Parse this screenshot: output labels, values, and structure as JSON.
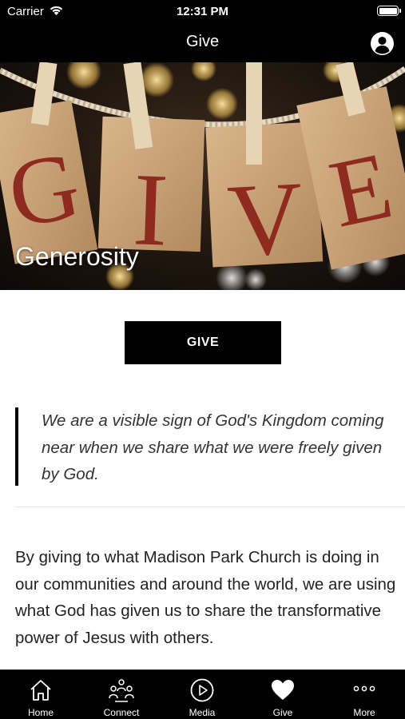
{
  "status_bar": {
    "carrier": "Carrier",
    "time": "12:31 PM"
  },
  "nav": {
    "title": "Give",
    "profile_icon": "person-icon"
  },
  "hero": {
    "title": "Generosity",
    "letters": [
      "G",
      "I",
      "V",
      "E"
    ]
  },
  "give_button": {
    "label": "GIVE"
  },
  "quote": {
    "text": "We are a visible sign of God's Kingdom coming near when we share what we were freely given by God."
  },
  "body": {
    "text": "By giving to what Madison Park Church is doing in our communities and around the world, we are using what God has given us to share the transformative power of Jesus with others."
  },
  "tab_bar": {
    "active": "Give",
    "items": [
      {
        "label": "Home",
        "icon": "home-icon"
      },
      {
        "label": "Connect",
        "icon": "people-icon"
      },
      {
        "label": "Media",
        "icon": "play-icon"
      },
      {
        "label": "Give",
        "icon": "heart-icon"
      },
      {
        "label": "More",
        "icon": "more-icon"
      }
    ]
  },
  "colors": {
    "bars": "#000000",
    "accent_text": "#ffffff",
    "card_letter": "#8e2a1f"
  }
}
